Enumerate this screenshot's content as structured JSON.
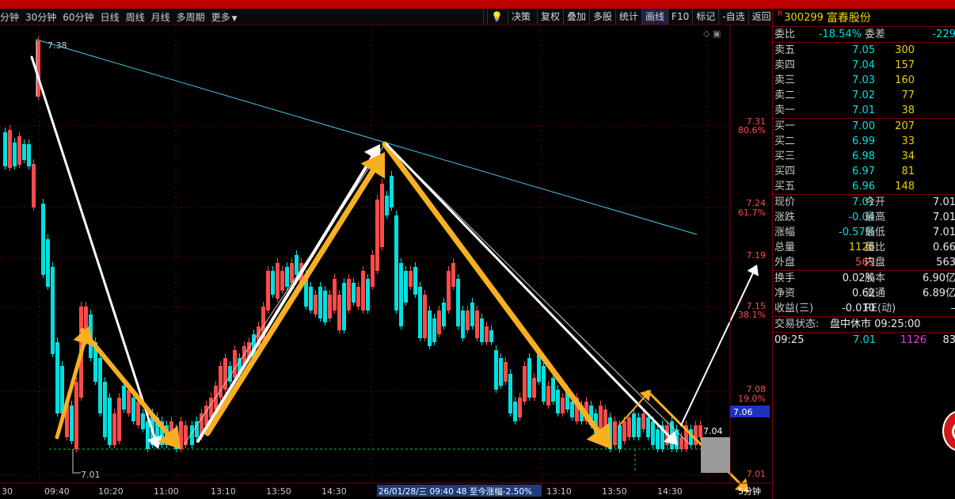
{
  "toolbar": {
    "left_items": [
      "分钟",
      "30分钟",
      "60分钟",
      "日线",
      "周线",
      "月线",
      "多周期",
      "更多"
    ],
    "right_items": [
      "决策",
      "复权",
      "叠加",
      "多股",
      "统计",
      "画线",
      "F10",
      "标记",
      "-自选",
      "返回"
    ],
    "active_item": "画线"
  },
  "chart": {
    "price_labels": [
      "7.38",
      "7.01"
    ],
    "right_axis": [
      {
        "price": "7.31",
        "pct": "80.6%"
      },
      {
        "price": "7.24",
        "pct": "61.7%"
      },
      {
        "price": "7.19",
        "pct": ""
      },
      {
        "price": "7.15",
        "pct": "38.1%"
      },
      {
        "price": "7.08",
        "pct": "19.0%"
      },
      {
        "price": "7.01",
        "pct": ""
      }
    ],
    "current_price_tag": "7.06",
    "last_price_marker": "7.04",
    "time_labels": [
      "30",
      "09:40",
      "10:20",
      "11:00",
      "13:10",
      "13:50",
      "14:30",
      "13:10",
      "13:50",
      "14:30"
    ],
    "info_label": "26/01/28/三 09:40 48 至今涨幅-2.50%",
    "period_label": "5分钟"
  },
  "panel": {
    "code": "300299",
    "name": "富春股份",
    "weibi": {
      "label": "委比",
      "value": "-18.54%",
      "label2": "委差",
      "value2": "-229"
    },
    "sell": [
      {
        "label": "卖五",
        "price": "7.05",
        "vol": "300"
      },
      {
        "label": "卖四",
        "price": "7.04",
        "vol": "157"
      },
      {
        "label": "卖三",
        "price": "7.03",
        "vol": "160"
      },
      {
        "label": "卖二",
        "price": "7.02",
        "vol": "77"
      },
      {
        "label": "卖一",
        "price": "7.01",
        "vol": "38"
      }
    ],
    "buy": [
      {
        "label": "买一",
        "price": "7.00",
        "vol": "207"
      },
      {
        "label": "买二",
        "price": "6.99",
        "vol": "33"
      },
      {
        "label": "买三",
        "price": "6.98",
        "vol": "34"
      },
      {
        "label": "买四",
        "price": "6.97",
        "vol": "81"
      },
      {
        "label": "买五",
        "price": "6.96",
        "vol": "148"
      }
    ],
    "stats": [
      {
        "l1": "现价",
        "v1": "7.01",
        "l2": "今开",
        "v2": "7.01"
      },
      {
        "l1": "涨跌",
        "v1": "-0.04",
        "l2": "最高",
        "v2": "7.01"
      },
      {
        "l1": "涨幅",
        "v1": "-0.57%",
        "l2": "最低",
        "v2": "7.01"
      },
      {
        "l1": "总量",
        "v1": "1126",
        "l2": "量比",
        "v2": "0.66"
      },
      {
        "l1": "外盘",
        "v1": "563",
        "l2": "内盘",
        "v2": "563"
      }
    ],
    "stats2": [
      {
        "l1": "换手",
        "v1": "0.02%",
        "l2": "股本",
        "v2": "6.90亿"
      },
      {
        "l1": "净资",
        "v1": "0.62",
        "l2": "流通",
        "v2": "6.89亿"
      },
      {
        "l1": "收益(三)",
        "v1": "-0.010",
        "l2": "PE(动)",
        "v2": "–"
      }
    ],
    "status": {
      "label": "交易状态:",
      "value": "盘中休市 09:25:00"
    },
    "tick": {
      "time": "09:25",
      "price": "7.01",
      "vol": "1126",
      "extra": "83"
    }
  },
  "colors": {
    "up": "#ff4a4a",
    "down": "#00e0e0",
    "trend": "#40c8e8",
    "arrow_orange": "#f8b020",
    "arrow_white": "#ffffff",
    "dash": "#20c040"
  }
}
